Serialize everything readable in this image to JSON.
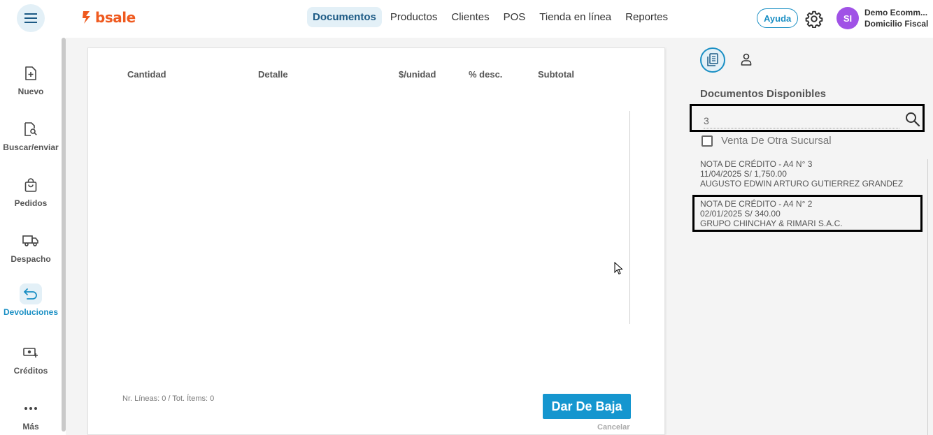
{
  "header": {
    "logo_text": "bsale",
    "nav": [
      {
        "label": "Documentos",
        "active": true
      },
      {
        "label": "Productos",
        "active": false
      },
      {
        "label": "Clientes",
        "active": false
      },
      {
        "label": "POS",
        "active": false
      },
      {
        "label": "Tienda en línea",
        "active": false
      },
      {
        "label": "Reportes",
        "active": false
      }
    ],
    "help_label": "Ayuda",
    "avatar_initials": "SI",
    "user_name": "Demo Ecomm...",
    "user_sub": "Domicilio Fiscal",
    "brand_color": "#ef5a1f",
    "accent_color": "#1a8fc4"
  },
  "sidebar": {
    "items": [
      {
        "label": "Nuevo",
        "icon": "file-plus-icon"
      },
      {
        "label": "Buscar/enviar",
        "icon": "file-search-icon"
      },
      {
        "label": "Pedidos",
        "icon": "shopping-bag-icon"
      },
      {
        "label": "Despacho",
        "icon": "truck-icon"
      },
      {
        "label": "Devoluciones",
        "icon": "return-arrow-icon",
        "active": true
      },
      {
        "label": "Créditos",
        "icon": "money-plus-icon"
      },
      {
        "label": "Más",
        "icon": "more-dots-icon"
      }
    ]
  },
  "document": {
    "columns": [
      "Cantidad",
      "Detalle",
      "$/unidad",
      "% desc.",
      "Subtotal"
    ],
    "footer_info": "Nr. Líneas: 0 / Tot. Ítems: 0",
    "submit_label": "Dar De Baja",
    "cancel_label": "Cancelar"
  },
  "right_panel": {
    "title": "Documentos Disponibles",
    "search_value": "3",
    "checkbox_label": "Venta De Otra Sucursal",
    "documents": [
      {
        "line1": "NOTA DE CRÉDITO - A4 N° 3",
        "line2": "11/04/2025 S/ 1,750.00",
        "line3": "AUGUSTO EDWIN ARTURO GUTIERREZ GRANDEZ"
      },
      {
        "line1": "NOTA DE CRÉDITO - A4 N° 2",
        "line2": "02/01/2025 S/ 340.00",
        "line3": "GRUPO CHINCHAY & RIMARI S.A.C."
      }
    ]
  }
}
